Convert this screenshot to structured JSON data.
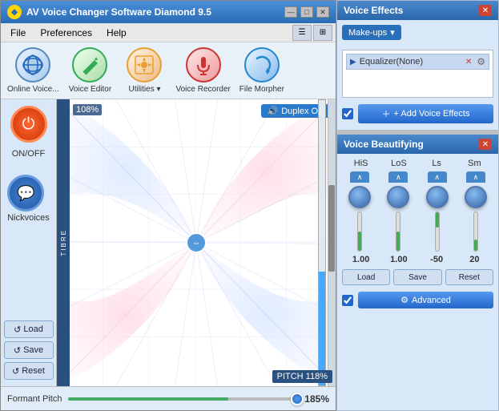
{
  "window": {
    "title": "AV Voice Changer Software Diamond 9.5",
    "icon": "◆"
  },
  "title_buttons": {
    "minimize": "—",
    "maximize": "□",
    "close": "✕"
  },
  "menu": {
    "items": [
      "File",
      "Preferences",
      "Help"
    ]
  },
  "toolbar": {
    "view1": "☰",
    "view2": "⊞"
  },
  "icons": [
    {
      "id": "online-voice",
      "emoji": "🌐",
      "label": "Online Voice...",
      "bg": "#2266bb"
    },
    {
      "id": "voice-editor",
      "emoji": "✏️",
      "label": "Voice Editor",
      "bg": "#33aa55"
    },
    {
      "id": "utilities",
      "emoji": "⚙",
      "label": "Utilities ▾",
      "bg": "#e8a030"
    },
    {
      "id": "voice-recorder",
      "emoji": "🎤",
      "label": "Voice Recorder",
      "bg": "#cc3333"
    },
    {
      "id": "file-morpher",
      "emoji": "🔄",
      "label": "File Morpher",
      "bg": "#2288cc"
    }
  ],
  "left_panel": {
    "power_icon": "⏻",
    "on_off_label": "ON/OFF",
    "nick_icon": "💬",
    "nick_label": "Nickvoices",
    "load_label": "Load",
    "save_label": "Save",
    "reset_label": "Reset"
  },
  "morph_area": {
    "tibre_label": "T I B R E",
    "duplex_label": "Duplex ON",
    "pitch_label": "PITCH 118%",
    "percent_label": "108%",
    "duplex_icon": "🔊"
  },
  "formant": {
    "label": "Formant Pitch",
    "value": "185%",
    "slider_fill_pct": 70
  },
  "voice_effects": {
    "panel_title": "Voice Effects",
    "close_btn": "✕",
    "makeup_label": "Make-ups",
    "dropdown_arrow": "▾",
    "effect_items": [
      {
        "name": "Equalizer(None)",
        "arrow": "▶",
        "settings": "⚙",
        "remove": "✕"
      }
    ],
    "add_effects_label": "+ Add Voice Effects"
  },
  "voice_beautifying": {
    "panel_title": "Voice Beautifying",
    "close_btn": "✕",
    "columns": [
      {
        "label": "HiS",
        "value": "1.00",
        "fill_pct": 50,
        "negative": false
      },
      {
        "label": "LoS",
        "value": "1.00",
        "fill_pct": 50,
        "negative": false
      },
      {
        "label": "Ls",
        "value": "-50",
        "fill_pct": 40,
        "negative": true
      },
      {
        "label": "Sm",
        "value": "20",
        "fill_pct": 30,
        "negative": false
      }
    ],
    "load_label": "Load",
    "save_label": "Save",
    "reset_label": "Reset",
    "advanced_label": "Advanced",
    "advanced_icon": "⚙"
  }
}
